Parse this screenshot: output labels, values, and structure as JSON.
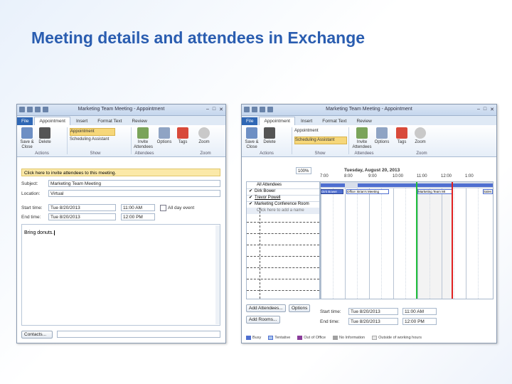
{
  "slide": {
    "title": "Meeting details and attendees in Exchange"
  },
  "left_window": {
    "title": "Marketing Team Meeting - Appointment",
    "tabs": [
      "File",
      "Appointment",
      "Insert",
      "Format Text",
      "Review"
    ],
    "ribbon": {
      "save_close": "Save & Close",
      "delete": "Delete",
      "appointment": "Appointment",
      "scheduling_assistant": "Scheduling Assistant",
      "invite": "Invite Attendees",
      "options": "Options",
      "tags": "Tags",
      "zoom": "Zoom",
      "group_actions": "Actions",
      "group_show": "Show",
      "group_attendees": "Attendees",
      "group_zoom": "Zoom"
    },
    "info_bar": "Click here to invite attendees to this meeting.",
    "subject_label": "Subject:",
    "subject": "Marketing Team Meeting",
    "location_label": "Location:",
    "location": "Virtual",
    "start_label": "Start time:",
    "start_date": "Tue 8/20/2013",
    "start_time": "11:00 AM",
    "allday_label": "All day event",
    "end_label": "End time:",
    "end_date": "Tue 8/20/2013",
    "end_time": "12:00 PM",
    "body": "Bring donuts.",
    "contacts_label": "Contacts..."
  },
  "right_window": {
    "title": "Marketing Team Meeting - Appointment",
    "tabs": [
      "File",
      "Appointment",
      "Insert",
      "Format Text",
      "Review"
    ],
    "ribbon": {
      "save_close": "Save & Close",
      "delete": "Delete",
      "appointment": "Appointment",
      "scheduling_assistant": "Scheduling Assistant",
      "invite": "Invite Attendees",
      "options": "Options",
      "tags": "Tags",
      "zoom": "Zoom",
      "group_actions": "Actions",
      "group_show": "Show",
      "group_attendees": "Attendees",
      "group_zoom": "Zoom"
    },
    "zoom_value": "100%",
    "date_header": "Tuesday, August 20, 2013",
    "hours": [
      "7:00",
      "8:00",
      "9:00",
      "10:00",
      "11:00",
      "12:00",
      "1:00"
    ],
    "attendees": [
      {
        "name": "All Attendees"
      },
      {
        "name": "Dirk Bower"
      },
      {
        "name": "Trevor Powell"
      },
      {
        "name": "Marketing Conference Room"
      }
    ],
    "add_row": "Click here to add a name",
    "busy_blocks": [
      {
        "label": "Dirk Bower"
      },
      {
        "label": "Office: Brian's Meeting"
      },
      {
        "label": "Marketing Team Mt"
      },
      {
        "label": "Sales"
      }
    ],
    "add_attendees": "Add Attendees...",
    "options_btn": "Options",
    "add_rooms": "Add Rooms...",
    "start_label": "Start time:",
    "start_date": "Tue 8/20/2013",
    "start_time": "11:00 AM",
    "end_label": "End time:",
    "end_date": "Tue 8/20/2013",
    "end_time": "12:00 PM",
    "legend": [
      "Busy",
      "Tentative",
      "Out of Office",
      "No Information",
      "Outside of working hours"
    ]
  },
  "colors": {
    "busy": "#4f6fd0",
    "tentative": "#a8c4ee",
    "ooo": "#8a3c9a",
    "noinfo": "#a0a0a0",
    "outside": "#e6e6e6",
    "start": "#22c03c",
    "end": "#e02020"
  }
}
